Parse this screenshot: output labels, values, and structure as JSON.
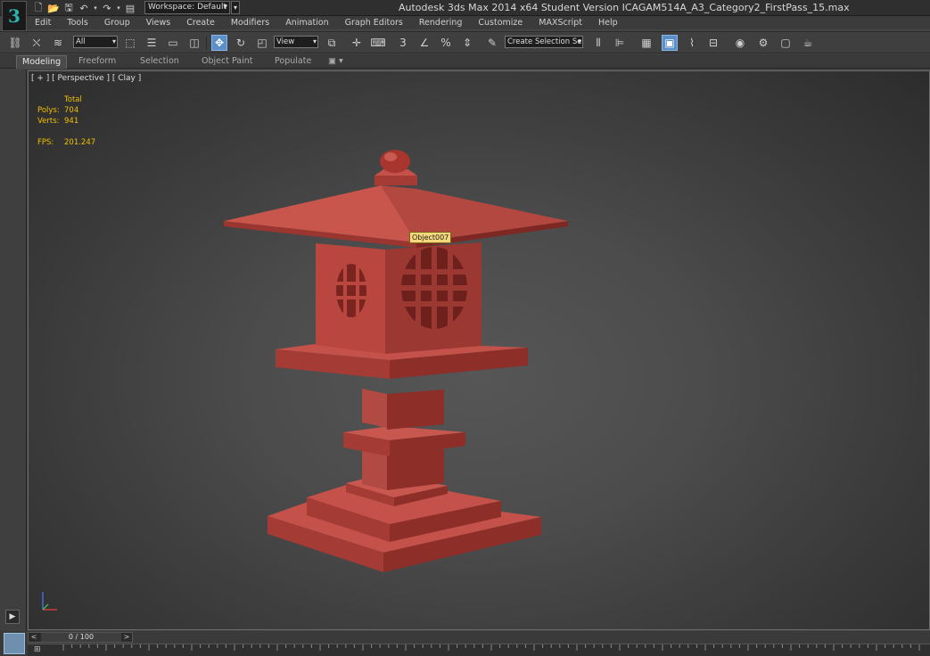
{
  "window": {
    "title": "Autodesk 3ds Max  2014 x64     Student Version    ICAGAM514A_A3_Category2_FirstPass_15.max",
    "workspace_label": "Workspace: Default"
  },
  "menu": [
    "Edit",
    "Tools",
    "Group",
    "Views",
    "Create",
    "Modifiers",
    "Animation",
    "Graph Editors",
    "Rendering",
    "Customize",
    "MAXScript",
    "Help"
  ],
  "toolbar": {
    "selection_filter": "All",
    "reference_coord": "View",
    "named_selection": "Create Selection Se"
  },
  "ribbon_tabs": [
    "Modeling",
    "Freeform",
    "Selection",
    "Object Paint",
    "Populate"
  ],
  "viewport": {
    "label": "[ + ] [ Perspective ] [ Clay ]",
    "stats": {
      "header": "Total",
      "polys_label": "Polys:",
      "polys_value": "704",
      "verts_label": "Verts:",
      "verts_value": "941",
      "fps_label": "FPS:",
      "fps_value": "201.247"
    },
    "object_tooltip": "Object007"
  },
  "timeline": {
    "frame_display": "0 / 100"
  },
  "colors": {
    "lantern_main": "#b8453d",
    "lantern_dark": "#8e2e28",
    "lantern_light": "#cc5a50",
    "stats_text": "#f0c000",
    "active_button": "#5a8fc8"
  },
  "icons": {
    "app_logo": "3ds-max-logo-icon",
    "play": "play-icon",
    "move": "move-icon",
    "rotate": "rotate-icon"
  }
}
